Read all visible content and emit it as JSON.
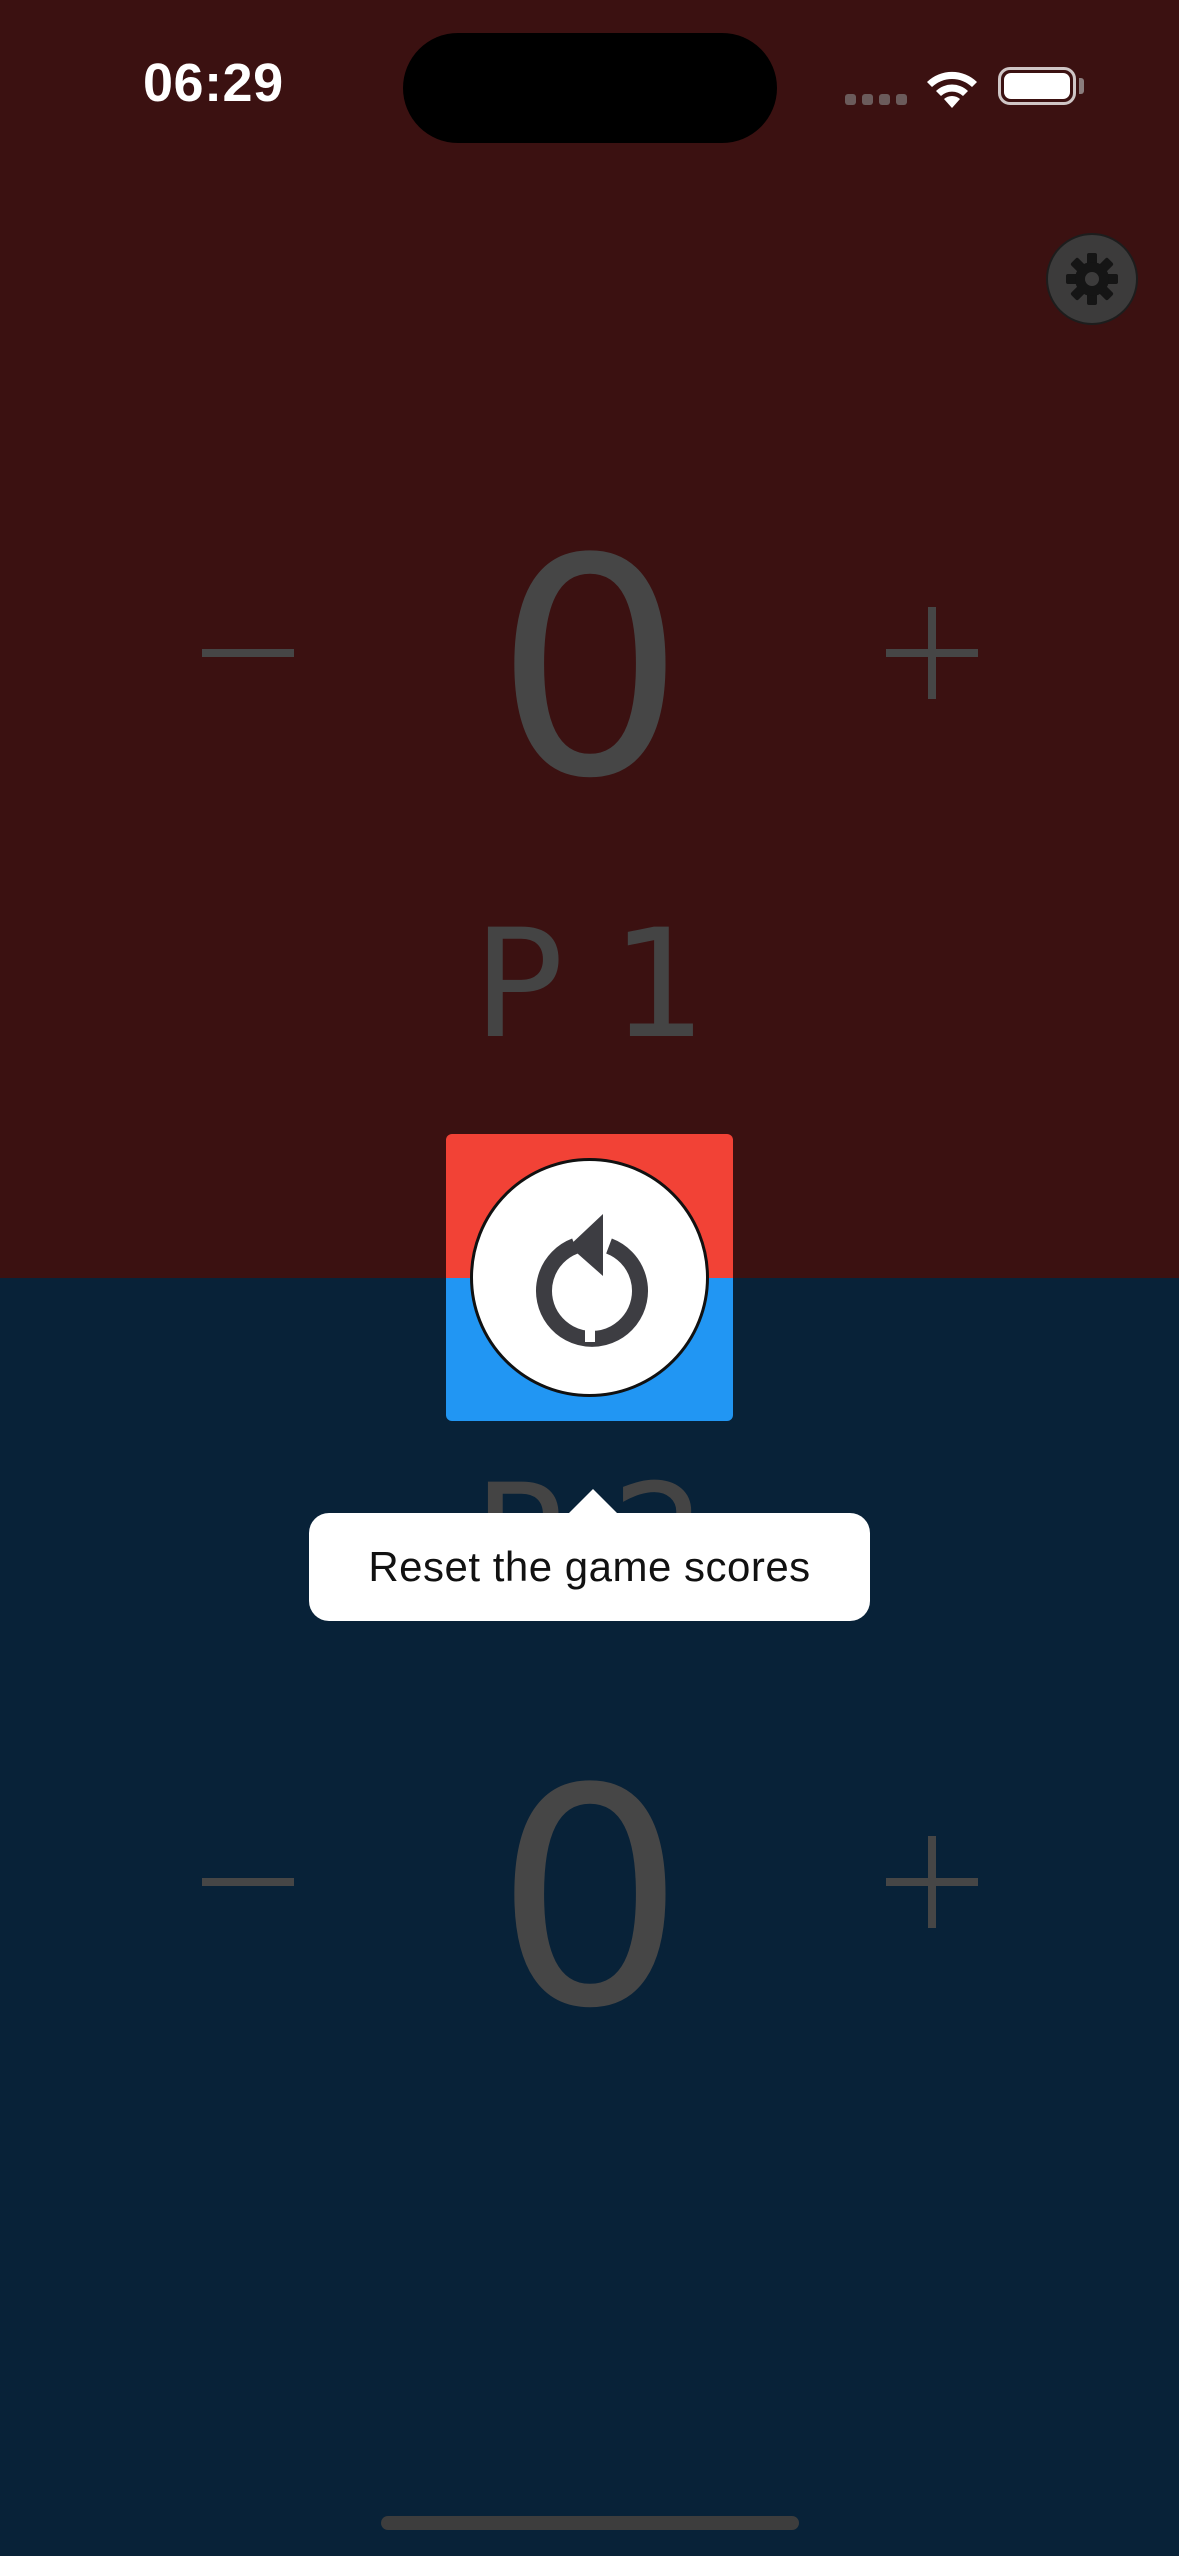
{
  "status_bar": {
    "time": "06:29"
  },
  "player1": {
    "label": "P 1",
    "score": "0",
    "minus_symbol": "−",
    "plus_symbol": "+",
    "color": "#3b1111",
    "accent": "#f24236"
  },
  "player2": {
    "label": "P 2",
    "score": "0",
    "minus_symbol": "−",
    "plus_symbol": "+",
    "color": "#082238",
    "accent": "#2196f3"
  },
  "reset": {
    "icon": "refresh-icon",
    "tooltip": "Reset the game scores"
  },
  "settings": {
    "icon": "gear-icon"
  }
}
